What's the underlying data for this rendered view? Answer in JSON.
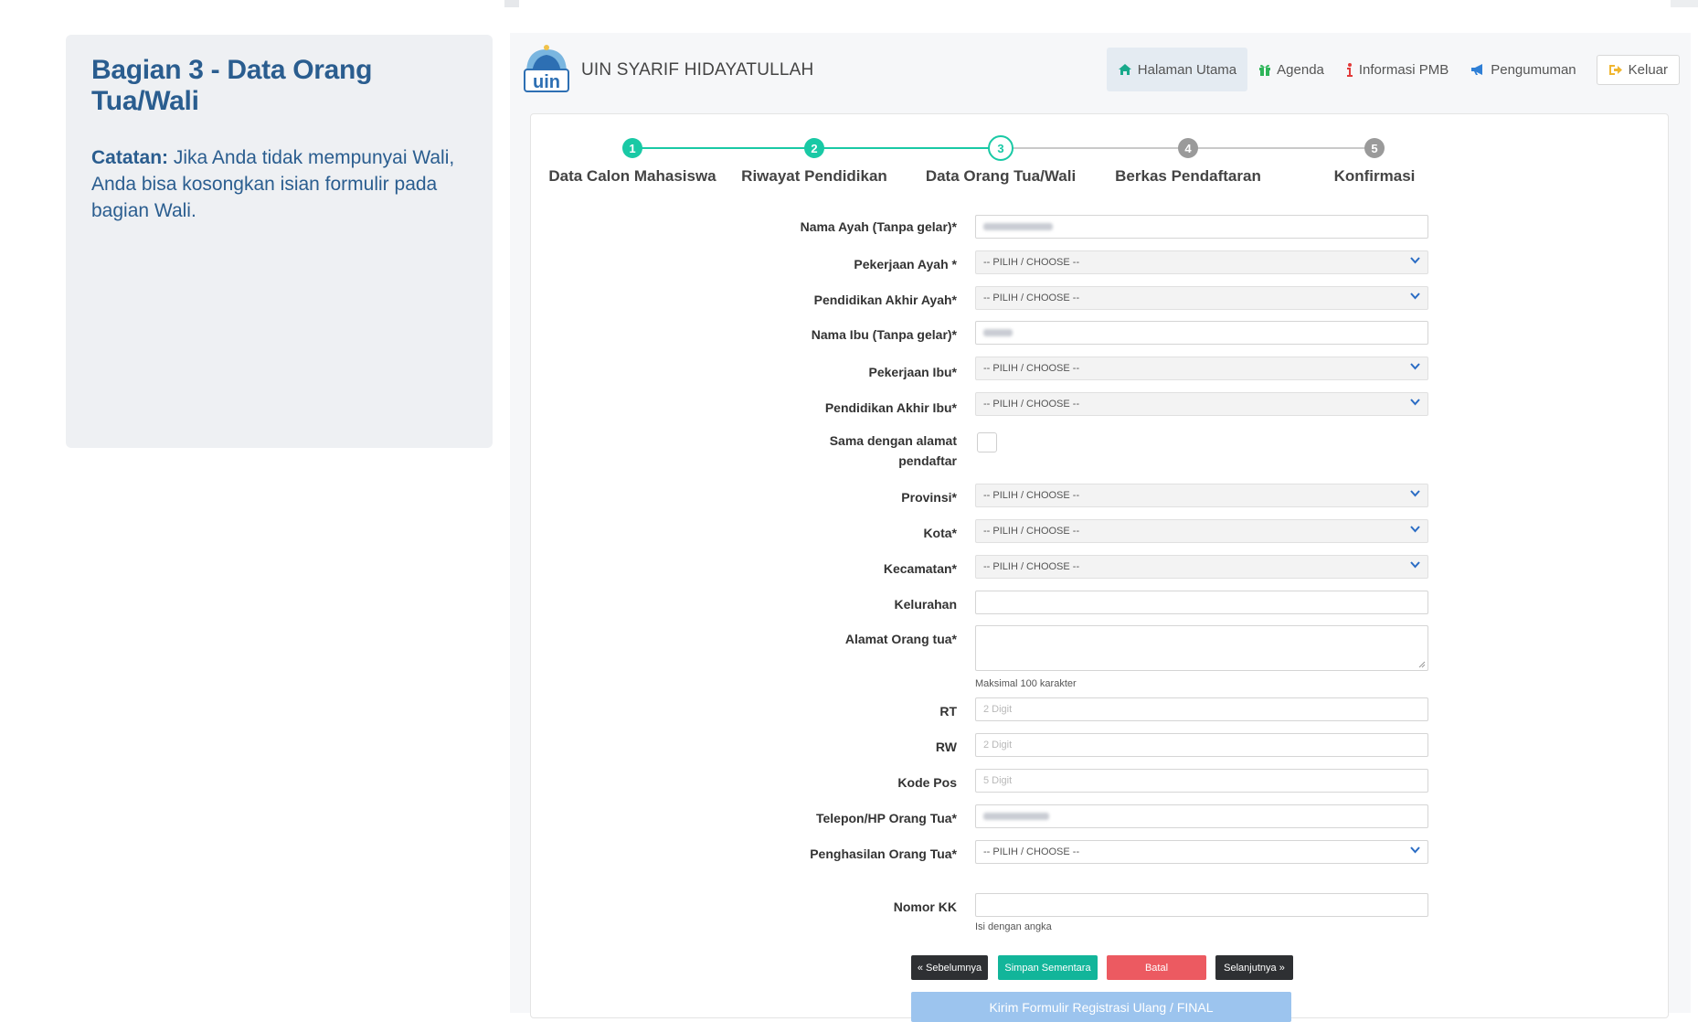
{
  "note": {
    "title": "Bagian 3 - Data Orang Tua/Wali",
    "bold_prefix": "Catatan:",
    "text": "Jika Anda tidak mempunyai Wali, Anda bisa kosongkan isian formulir pada bagian Wali."
  },
  "brand": {
    "name": "UIN SYARIF HIDAYATULLAH",
    "logo_text": "uin"
  },
  "nav": [
    {
      "label": "Halaman Utama",
      "icon": "home-icon",
      "color": "#18a98b"
    },
    {
      "label": "Agenda",
      "icon": "gift-icon",
      "color": "#2fb55a"
    },
    {
      "label": "Informasi PMB",
      "icon": "info-icon",
      "color": "#e23a3a"
    },
    {
      "label": "Pengumuman",
      "icon": "bullhorn-icon",
      "color": "#2f7fd6"
    },
    {
      "label": "Keluar",
      "icon": "sign-out-icon",
      "color": "#f0b630"
    }
  ],
  "steps": [
    {
      "num": "1",
      "label": "Data Calon Mahasiswa",
      "state": "done"
    },
    {
      "num": "2",
      "label": "Riwayat Pendidikan",
      "state": "done"
    },
    {
      "num": "3",
      "label": "Data Orang Tua/Wali",
      "state": "current"
    },
    {
      "num": "4",
      "label": "Berkas Pendaftaran",
      "state": "todo"
    },
    {
      "num": "5",
      "label": "Konfirmasi",
      "state": "todo"
    }
  ],
  "form": {
    "nama_ayah": {
      "label": "Nama Ayah (Tanpa gelar)*"
    },
    "pekerjaan_ayah": {
      "label": "Pekerjaan Ayah *",
      "value": "-- PILIH / CHOOSE --"
    },
    "pendidikan_ayah": {
      "label": "Pendidikan Akhir Ayah*",
      "value": "-- PILIH / CHOOSE --"
    },
    "nama_ibu": {
      "label": "Nama Ibu (Tanpa gelar)*"
    },
    "pekerjaan_ibu": {
      "label": "Pekerjaan Ibu*",
      "value": "-- PILIH / CHOOSE --"
    },
    "pendidikan_ibu": {
      "label": "Pendidikan Akhir Ibu*",
      "value": "-- PILIH / CHOOSE --"
    },
    "sama_alamat": {
      "label_line1": "Sama dengan alamat",
      "label_line2": "pendaftar"
    },
    "provinsi": {
      "label": "Provinsi*",
      "value": "-- PILIH / CHOOSE --"
    },
    "kota": {
      "label": "Kota*",
      "value": "-- PILIH / CHOOSE --"
    },
    "kecamatan": {
      "label": "Kecamatan*",
      "value": "-- PILIH / CHOOSE --"
    },
    "kelurahan": {
      "label": "Kelurahan"
    },
    "alamat": {
      "label": "Alamat Orang tua*",
      "help": "Maksimal 100 karakter"
    },
    "rt": {
      "label": "RT",
      "placeholder": "2 Digit"
    },
    "rw": {
      "label": "RW",
      "placeholder": "2 Digit"
    },
    "kode_pos": {
      "label": "Kode Pos",
      "placeholder": "5 Digit"
    },
    "telepon": {
      "label": "Telepon/HP Orang Tua*"
    },
    "penghasilan": {
      "label": "Penghasilan Orang Tua*",
      "value": "-- PILIH / CHOOSE --"
    },
    "nomor_kk": {
      "label": "Nomor KK",
      "help": "Isi dengan angka"
    }
  },
  "buttons": {
    "prev": "« Sebelumnya",
    "save": "Simpan Sementara",
    "cancel": "Batal",
    "next": "Selanjutnya »",
    "final": "Kirim Formulir Registrasi Ulang / FINAL"
  },
  "colors": {
    "accent": "#19c9a5",
    "title_blue": "#2a5d8f"
  }
}
